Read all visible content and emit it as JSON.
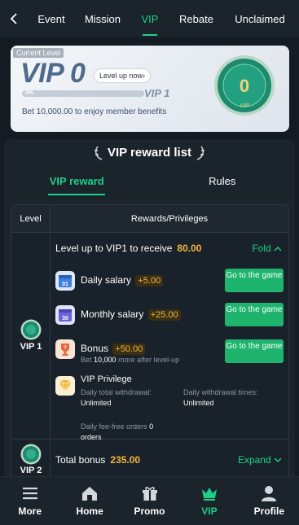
{
  "nav": {
    "tabs": [
      {
        "label": "Event"
      },
      {
        "label": "Mission"
      },
      {
        "label": "VIP"
      },
      {
        "label": "Rebate"
      },
      {
        "label": "Unclaimed"
      }
    ],
    "active_tab": "VIP"
  },
  "level_card": {
    "current_level_tag": "Current Level",
    "current_level": "VIP 0",
    "level_up_label": "Level up now",
    "progress_percent": 0,
    "progress_label": "0%",
    "next_level": "VIP 1",
    "bet_note": "Bet 10,000.00 to enjoy member benefits",
    "badge_number": "0",
    "badge_label": "VIP"
  },
  "rewards": {
    "title": "VIP reward list",
    "tabs": [
      {
        "label": "VIP reward"
      },
      {
        "label": "Rules"
      }
    ],
    "header": {
      "level": "Level",
      "rewards": "Rewards/Privileges"
    },
    "vip1": {
      "level_name": "VIP 1",
      "receive_text": "Level up to VIP1 to receive",
      "receive_amount": "80.00",
      "fold_label": "Fold",
      "items": [
        {
          "label": "Daily salary",
          "amount": "+5.00",
          "button": "Go to the game",
          "icon": "calendar-icon",
          "icon_day": "01"
        },
        {
          "label": "Monthly salary",
          "amount": "+25.00",
          "button": "Go to the game",
          "icon": "calendar-icon",
          "icon_day": "30"
        },
        {
          "label": "Bonus",
          "amount": "+50.00",
          "button": "Go to the game",
          "icon": "trophy-icon",
          "note_prefix": "Bet",
          "note_value": "10,000",
          "note_suffix": "more after level-up"
        }
      ],
      "privilege": {
        "label": "VIP Privilege",
        "daily_total_withdrawal_label": "Daily total withdrawal:",
        "daily_total_withdrawal_value": "Unlimited",
        "daily_withdrawal_times_label": "Daily withdrawal times:",
        "daily_withdrawal_times_value": "Unlimited",
        "fee_free_label": "Daily fee-free orders",
        "fee_free_value": "0",
        "fee_free_unit": "orders"
      }
    },
    "vip2": {
      "level_name": "VIP 2",
      "total_label": "Total bonus",
      "total_amount": "235.00",
      "expand_label": "Expand"
    }
  },
  "bottom_nav": [
    {
      "label": "More",
      "icon": "menu-icon"
    },
    {
      "label": "Home",
      "icon": "home-icon"
    },
    {
      "label": "Promo",
      "icon": "gift-icon"
    },
    {
      "label": "VIP",
      "icon": "crown-icon"
    },
    {
      "label": "Profile",
      "icon": "user-icon"
    }
  ],
  "colors": {
    "accent": "#1fd08a",
    "amount": "#f2b53c",
    "button": "#1fb46e",
    "background": "#141b22"
  }
}
